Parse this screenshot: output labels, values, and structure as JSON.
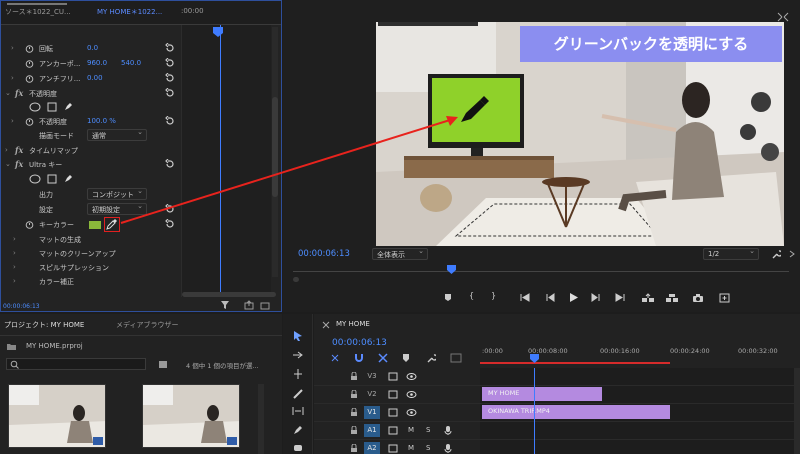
{
  "effect_controls": {
    "tab_source": "ソース＊1022_CU...",
    "tab_main": "MY HOME＊1022...",
    "tl_time": ":00:00",
    "rows": {
      "rotation": "回転",
      "rotation_val": "0.0",
      "anchor": "アンカーポ...",
      "anchor_x": "960.0",
      "anchor_y": "540.0",
      "antiflicker": "アンチフリ...",
      "antiflicker_val": "0.00",
      "opacity_header": "不透明度",
      "opacity": "不透明度",
      "opacity_val": "100.0 %",
      "blend_mode": "描画モード",
      "blend_mode_val": "通常",
      "time_remap": "タイムリマップ",
      "ultra_key": "Ultra キー",
      "output": "出力",
      "output_val": "コンポジット",
      "setting": "設定",
      "setting_val": "初期設定",
      "key_color": "キーカラー",
      "matte_gen": "マットの生成",
      "matte_cleanup": "マットのクリーンアップ",
      "spill": "スピルサプレッション",
      "color_correct": "カラー補正"
    },
    "key_color_swatch": "#8ab83a",
    "bottom_time": "00:00:06:13"
  },
  "program_monitor": {
    "banner": "グリーンバックを透明にする",
    "banner_color": "#8b8ef0",
    "timecode": "00:00:06:13",
    "fit": "全体表示",
    "resolution": "1/2",
    "transport": [
      "marker",
      "in",
      "out",
      "go-to-in",
      "step-back",
      "play",
      "step-forward",
      "go-to-out",
      "lift",
      "extract",
      "export-frame",
      "button-editor"
    ]
  },
  "project": {
    "tab_project": "プロジェクト: MY HOME",
    "tab_media": "メディアブラウザー",
    "file": "MY HOME.prproj",
    "selection_info": "4 個中 1 個の項目が選..."
  },
  "timeline": {
    "tab": "MY HOME",
    "timecode": "00:00:06:13",
    "ruler": [
      ":00:00",
      "00:00:08:00",
      "00:00:16:00",
      "00:00:24:00",
      "00:00:32:00"
    ],
    "tracks": [
      "V3",
      "V2",
      "V1",
      "A1",
      "A2"
    ],
    "clip_v2": "MY HOME",
    "clip_v1": "OKINAWA TRIP.MP4",
    "clip_color": "#b48ae0"
  }
}
